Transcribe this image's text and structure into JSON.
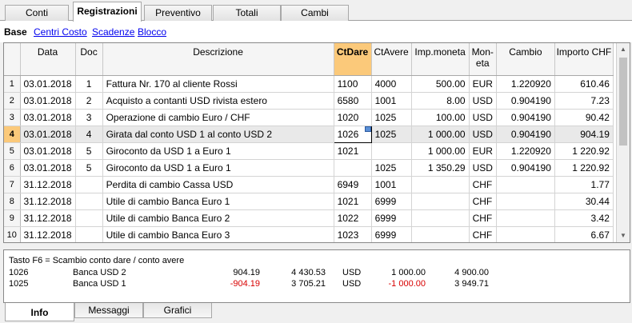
{
  "tabs": [
    "Conti",
    "Registrazioni",
    "Preventivo",
    "Totali",
    "Cambi"
  ],
  "subnav": {
    "current": "Base",
    "links": [
      "Centri Costo",
      "Scadenze",
      "Blocco"
    ]
  },
  "columns": [
    "",
    "Data",
    "Doc",
    "Descrizione",
    "CtDare",
    "CtAvere",
    "Imp.moneta",
    "Mon-\neta",
    "Cambio",
    "Importo CHF"
  ],
  "rows": [
    [
      "1",
      "03.01.2018",
      "1",
      "Fattura Nr. 170 al cliente Rossi",
      "1100",
      "4000",
      "500.00",
      "EUR",
      "1.220920",
      "610.46"
    ],
    [
      "2",
      "03.01.2018",
      "2",
      "Acquisto a contanti USD rivista estero",
      "6580",
      "1001",
      "8.00",
      "USD",
      "0.904190",
      "7.23"
    ],
    [
      "3",
      "03.01.2018",
      "3",
      "Operazione di cambio Euro / CHF",
      "1020",
      "1025",
      "100.00",
      "USD",
      "0.904190",
      "90.42"
    ],
    [
      "4",
      "03.01.2018",
      "4",
      "Girata dal conto USD 1 al conto USD 2",
      "1026",
      "1025",
      "1 000.00",
      "USD",
      "0.904190",
      "904.19"
    ],
    [
      "5",
      "03.01.2018",
      "5",
      "Giroconto da USD 1 a Euro 1",
      "1021",
      "",
      "1 000.00",
      "EUR",
      "1.220920",
      "1 220.92"
    ],
    [
      "6",
      "03.01.2018",
      "5",
      "Giroconto da USD 1 a Euro 1",
      "",
      "1025",
      "1 350.29",
      "USD",
      "0.904190",
      "1 220.92"
    ],
    [
      "7",
      "31.12.2018",
      "",
      "Perdita di cambio Cassa USD",
      "6949",
      "1001",
      "",
      "CHF",
      "",
      "1.77"
    ],
    [
      "8",
      "31.12.2018",
      "",
      "Utile di cambio Banca Euro 1",
      "1021",
      "6999",
      "",
      "CHF",
      "",
      "30.44"
    ],
    [
      "9",
      "31.12.2018",
      "",
      "Utile di cambio Banca Euro 2",
      "1022",
      "6999",
      "",
      "CHF",
      "",
      "3.42"
    ],
    [
      "10",
      "31.12.2018",
      "",
      "Utile di cambio Banca Euro 3",
      "1023",
      "6999",
      "",
      "CHF",
      "",
      "6.67"
    ]
  ],
  "info": {
    "hint": "Tasto F6 = Scambio conto dare / conto avere",
    "lines": [
      {
        "account": "1026",
        "name": "Banca USD 2",
        "amount": "904.19",
        "balance": "4 430.53",
        "currency": "USD",
        "amount_cur": "1 000.00",
        "balance_cur": "4 900.00"
      },
      {
        "account": "1025",
        "name": "Banca USD 1",
        "amount": "-904.19",
        "balance": "3 705.21",
        "currency": "USD",
        "amount_cur": "-1 000.00",
        "balance_cur": "3 949.71"
      }
    ]
  },
  "bottom_tabs": [
    "Info",
    "Messaggi",
    "Grafici"
  ],
  "colors": {
    "highlight": "#fbc97a",
    "negative": "#d80000",
    "link": "#0000ee"
  }
}
